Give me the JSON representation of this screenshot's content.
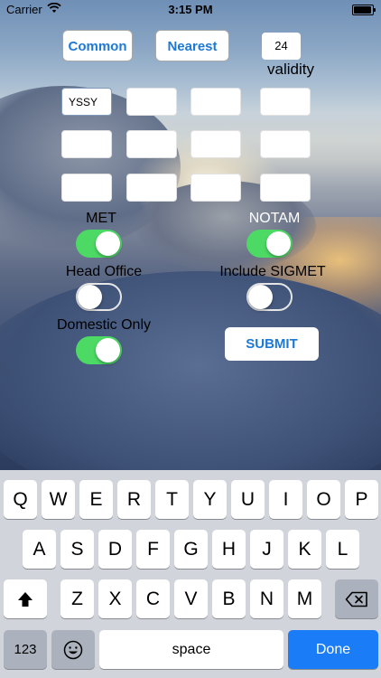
{
  "status_bar": {
    "carrier": "Carrier",
    "time": "3:15 PM"
  },
  "buttons": {
    "common": "Common",
    "nearest": "Nearest",
    "submit": "SUBMIT"
  },
  "validity": {
    "value": "24",
    "label": "validity"
  },
  "code_inputs": [
    [
      "YSSY",
      "",
      "",
      ""
    ],
    [
      "",
      "",
      "",
      ""
    ],
    [
      "",
      "",
      "",
      ""
    ]
  ],
  "options": {
    "met": {
      "label": "MET",
      "on": true
    },
    "notam": {
      "label": "NOTAM",
      "on": true
    },
    "head_office": {
      "label": "Head Office",
      "on": false
    },
    "include_sigmet": {
      "label": "Include SIGMET",
      "on": false
    },
    "domestic_only": {
      "label": "Domestic Only",
      "on": true
    }
  },
  "keyboard": {
    "row1": [
      "Q",
      "W",
      "E",
      "R",
      "T",
      "Y",
      "U",
      "I",
      "O",
      "P"
    ],
    "row2": [
      "A",
      "S",
      "D",
      "F",
      "G",
      "H",
      "J",
      "K",
      "L"
    ],
    "row3": [
      "Z",
      "X",
      "C",
      "V",
      "B",
      "N",
      "M"
    ],
    "numbers_key": "123",
    "space_key": "space",
    "done_key": "Done"
  },
  "colors": {
    "accent": "#1d79d6",
    "toggle_on": "#4cd964",
    "done_key": "#1a7cf6",
    "keyboard_bg": "#d1d5db"
  },
  "icons": {
    "wifi": "wifi-icon",
    "battery": "battery-icon",
    "shift": "shift-arrow-icon",
    "backspace": "backspace-icon",
    "emoji": "emoji-icon"
  }
}
